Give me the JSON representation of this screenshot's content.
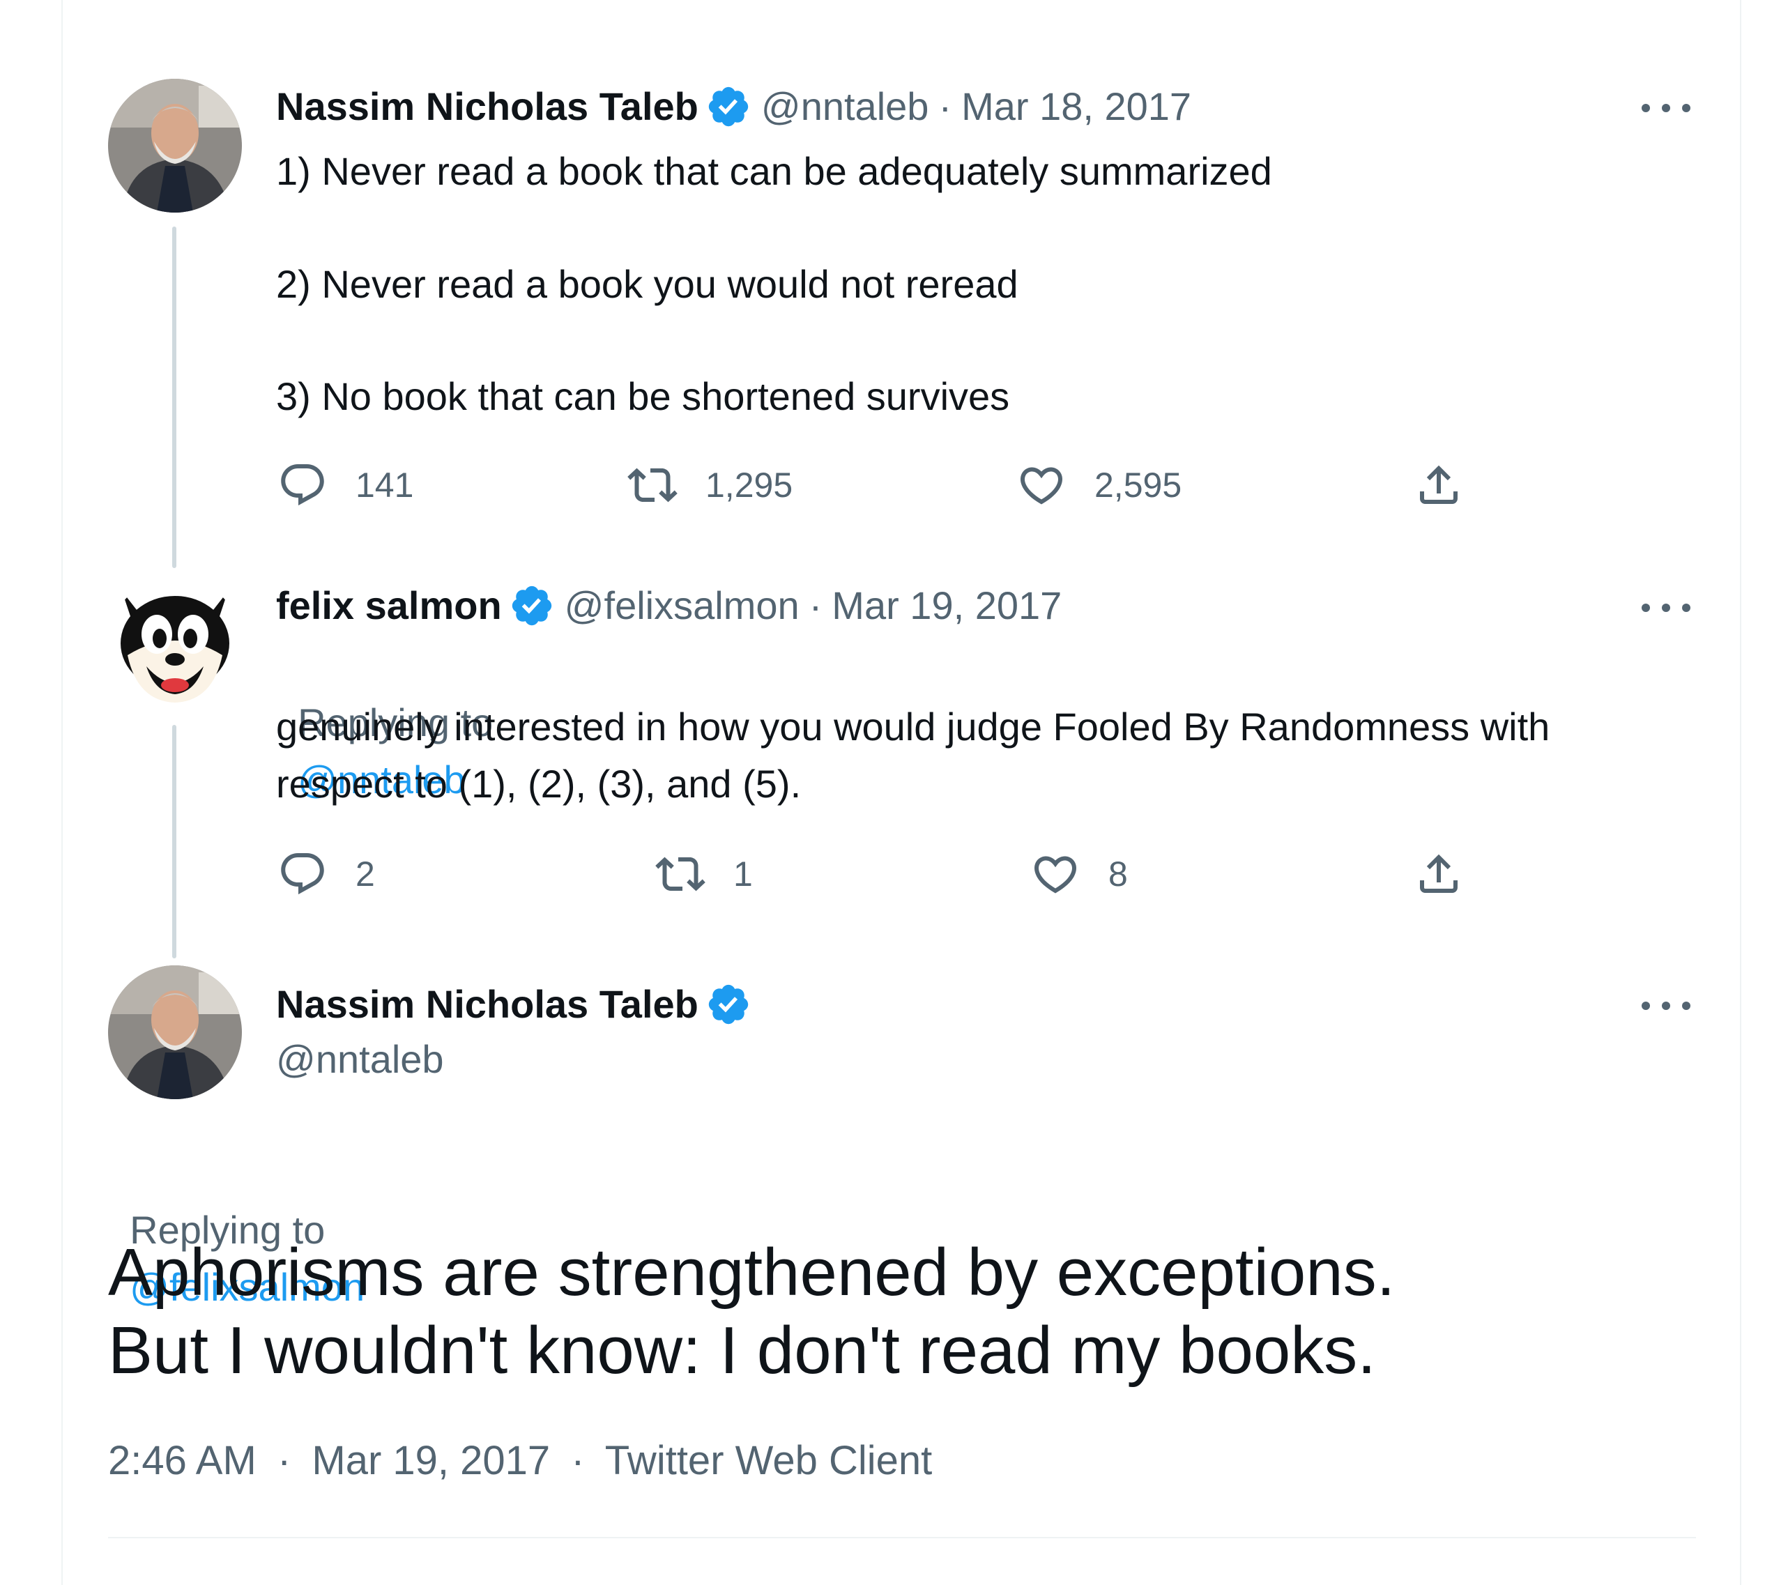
{
  "tweet1": {
    "name": "Nassim Nicholas Taleb",
    "handle": "@nntaleb",
    "separator": "·",
    "date": "Mar 18, 2017",
    "line1": "1) Never read a book that can be adequately summarized",
    "line2": "2) Never read a book you would not reread",
    "line3": "3) No book that can be shortened survives",
    "replies": "141",
    "retweets": "1,295",
    "likes": "2,595"
  },
  "tweet2": {
    "name": "felix salmon",
    "handle": "@felixsalmon",
    "separator": "·",
    "date": "Mar 19, 2017",
    "replying_prefix": "Replying to",
    "replying_to": "@nntaleb",
    "line1": "genuinely interested in how you would judge Fooled By Randomness with",
    "line2": "respect to (1), (2), (3), and (5).",
    "replies": "2",
    "retweets": "1",
    "likes": "8"
  },
  "main_tweet": {
    "name": "Nassim Nicholas Taleb",
    "handle": "@nntaleb",
    "replying_prefix": "Replying to",
    "replying_to": "@felixsalmon",
    "text_line1": "Aphorisms are strengthened by exceptions.",
    "text_line2": "But I wouldn't know: I don't read my books.",
    "time": "2:46 AM",
    "separator": "·",
    "date": "Mar 19, 2017",
    "client": "Twitter Web Client"
  },
  "icons": {
    "verified": "verified-badge-icon",
    "reply": "reply-icon",
    "retweet": "retweet-icon",
    "like": "heart-icon",
    "share": "share-icon",
    "more": "more-icon"
  },
  "colors": {
    "accent": "#1d9bf0",
    "muted": "#536471",
    "text": "#0f1419",
    "thread_line": "#cfd9de"
  }
}
